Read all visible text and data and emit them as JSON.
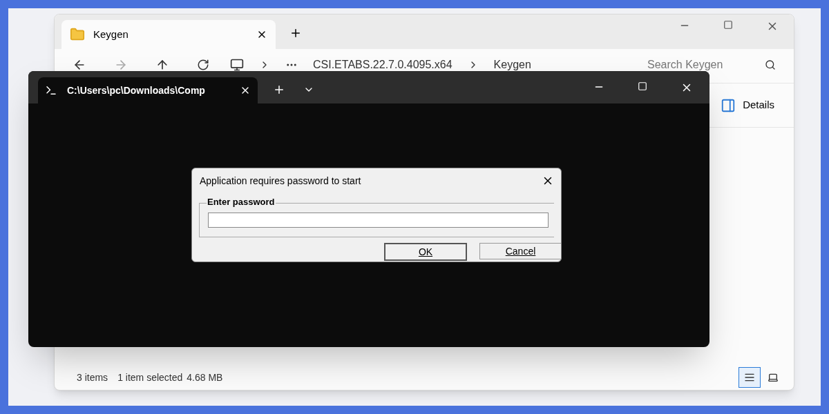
{
  "explorer": {
    "tab": {
      "title": "Keygen"
    },
    "breadcrumb": [
      "CSI.ETABS.22.7.0.4095.x64",
      "Keygen"
    ],
    "search": {
      "placeholder": "Search Keygen"
    },
    "details_button": "Details",
    "status_bar": {
      "count": "3 items",
      "selection": "1 item selected",
      "size": "4.68 MB"
    },
    "view_buttons": [
      {
        "kind": "details",
        "selected": true
      },
      {
        "kind": "tiles",
        "selected": false
      }
    ]
  },
  "terminal": {
    "tab": {
      "title": "C:\\Users\\pc\\Downloads\\Comp"
    }
  },
  "dialog": {
    "title": "Application requires password to start",
    "group_label": "Enter password",
    "buttons": [
      {
        "label": "OK",
        "default": true
      },
      {
        "label": "Cancel",
        "default": false
      }
    ]
  }
}
